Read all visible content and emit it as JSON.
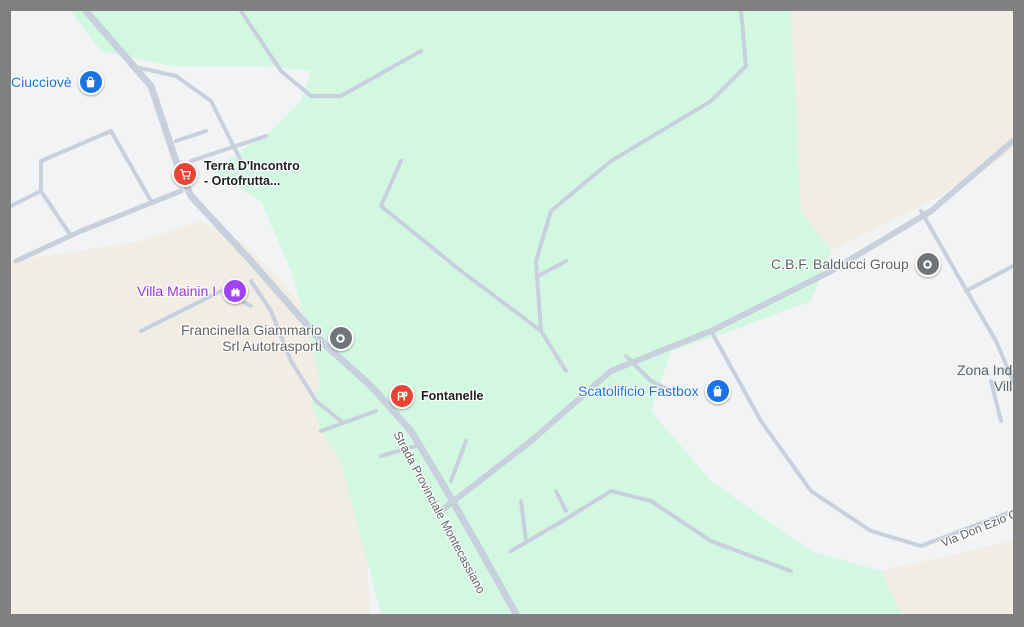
{
  "pois": {
    "ciucciove": {
      "label": "Ciucciovè",
      "icon": "shopping-bag-icon",
      "color": "#1a73e8"
    },
    "terra": {
      "label_line1": "Terra D'Incontro",
      "label_line2": "- Ortofrutta...",
      "icon": "shopping-cart-icon",
      "color": "#ea4335"
    },
    "villa": {
      "label": "Villa Mainin I",
      "icon": "castle-icon",
      "color": "#a142f4"
    },
    "francinella": {
      "label_line1": "Francinella Giammario",
      "label_line2": "Srl Autotrasporti",
      "icon": "place-dot-icon",
      "color": "#70757a"
    },
    "fontanelle": {
      "label": "Fontanelle",
      "icon": "restaurant-icon",
      "color": "#ea4335"
    },
    "balducci": {
      "label": "C.B.F. Balducci Group",
      "icon": "place-dot-icon",
      "color": "#70757a"
    },
    "scatolificio": {
      "label": "Scatolificio Fastbox",
      "icon": "shopping-bag-icon",
      "color": "#1a73e8"
    }
  },
  "area_label": {
    "line1": "Zona Ind",
    "line2": "Vill"
  },
  "roads": {
    "provinciale": "Strada Provinciale Montecassiano",
    "don_ezio": "Via Don Ezio C"
  },
  "colors": {
    "park": "#d3f8e2",
    "urban": "#f1f3f4",
    "farmland": "#f1ede4",
    "road": "#c8d0dd",
    "frame": "#808080"
  }
}
